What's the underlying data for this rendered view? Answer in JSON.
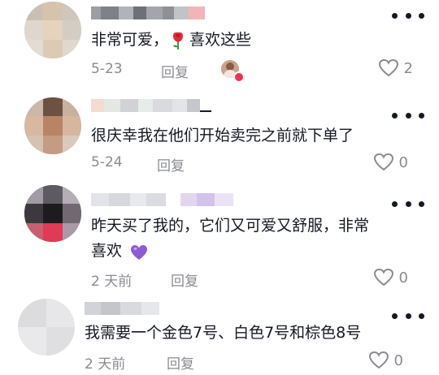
{
  "comments": [
    {
      "text_before": "非常可爱，",
      "emoji": "rose-icon",
      "text_after": "喜欢这些",
      "date": "5-23",
      "reply_label": "回复",
      "likes": "2",
      "liked_by_author": true
    },
    {
      "text_line1": "很庆幸我在他们开始卖完之前就下单了",
      "date": "5-24",
      "reply_label": "回复",
      "likes": "0"
    },
    {
      "text_line1": "昨天买了我的，它们又可爱又舒服，非常",
      "text_line2": "喜欢",
      "emoji": "purple-heart-icon",
      "date": "2 天前",
      "reply_label": "回复",
      "likes": "0"
    },
    {
      "text_line1": "我需要一个金色7号、白色7号和棕色8号",
      "date": "2 天前",
      "reply_label": "回复",
      "likes": "0"
    }
  ],
  "colors": {
    "text": "#161823",
    "meta": "#8a8b91",
    "rose": "#e02b3a",
    "purple_heart": "#8e5ad6",
    "author_badge": "#fe2c55"
  }
}
